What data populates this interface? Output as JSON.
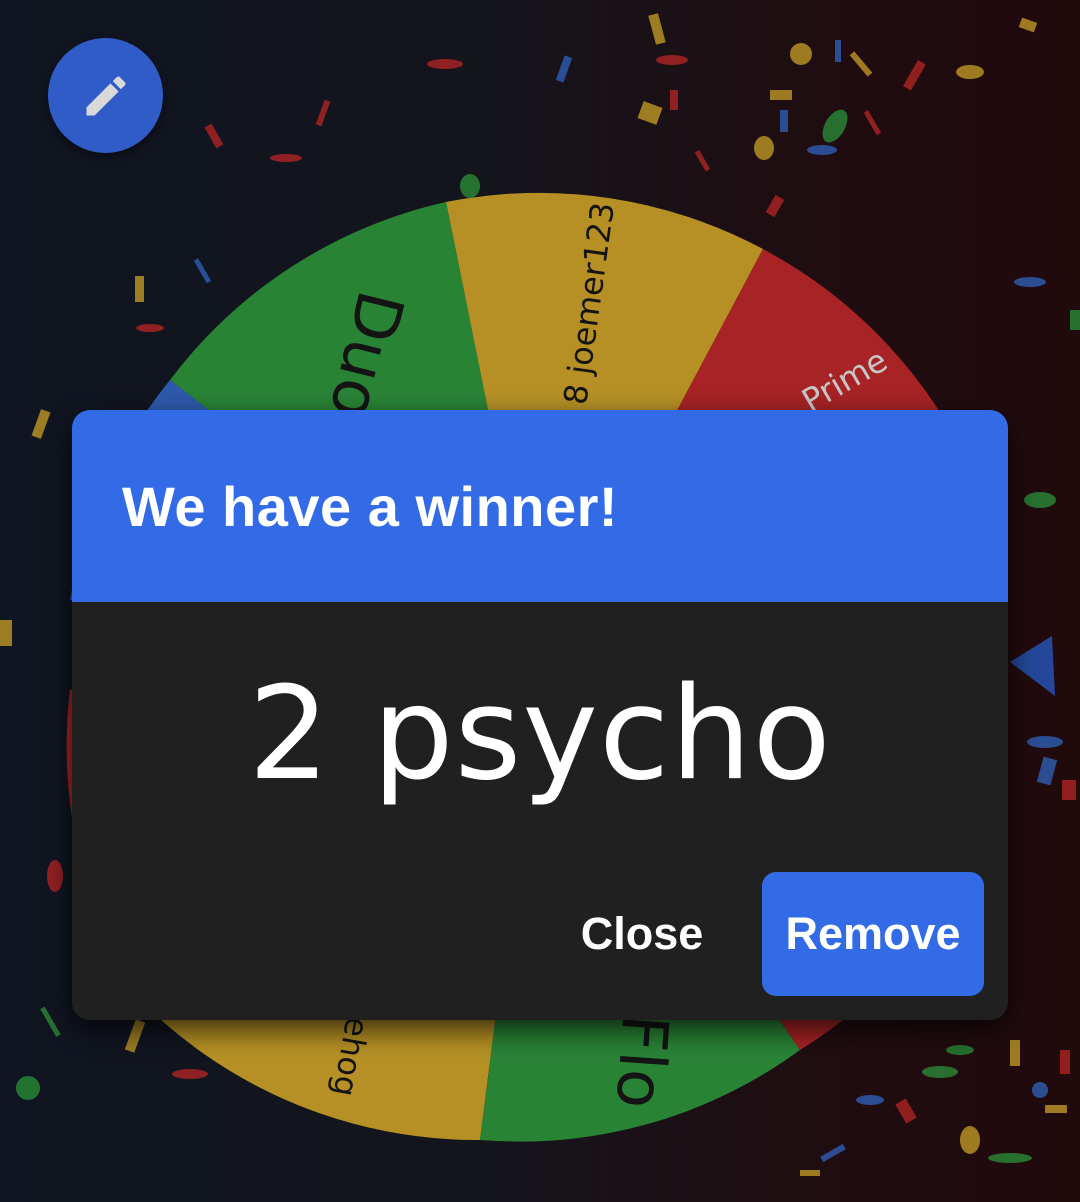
{
  "wheel": {
    "labels": [
      "Duo",
      "8 joemer123",
      "Prime",
      "Flo",
      "ehog"
    ],
    "colors": {
      "green": "#35a845",
      "yellow": "#e9b930",
      "red": "#d62d30",
      "blue": "#3b73dc"
    }
  },
  "edit_button": {
    "icon": "pencil-icon"
  },
  "dialog": {
    "title": "We have a winner!",
    "winner": "2 psycho",
    "close_label": "Close",
    "remove_label": "Remove"
  },
  "colors": {
    "accent": "#336be6",
    "dialog_bg": "#202020"
  }
}
